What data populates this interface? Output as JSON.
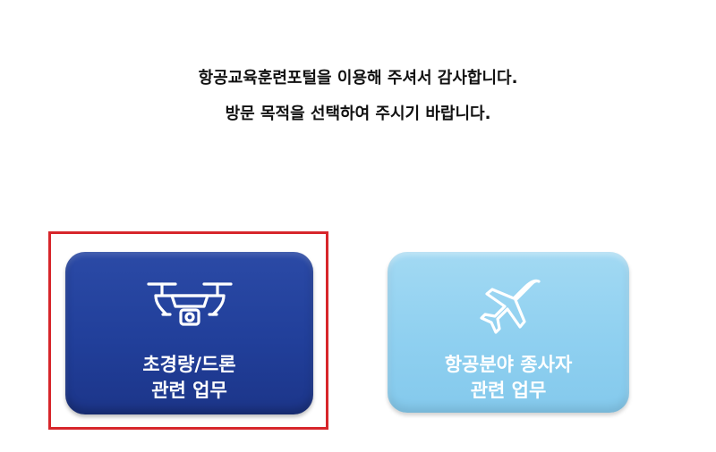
{
  "intro": {
    "line1": "항공교육훈련포털을 이용해 주셔서 감사합니다.",
    "line2": "방문 목적을 선택하여 주시기 바랍니다."
  },
  "options": [
    {
      "label_line1": "초경량/드론",
      "label_line2": "관련 업무",
      "icon": "drone-icon",
      "color": "#213f9a",
      "selected": true
    },
    {
      "label_line1": "항공분야 종사자",
      "label_line2": "관련 업무",
      "icon": "airplane-icon",
      "color": "#8fd0f0",
      "selected": false
    }
  ],
  "colors": {
    "selection_border": "#d7262b",
    "text": "#111111"
  }
}
